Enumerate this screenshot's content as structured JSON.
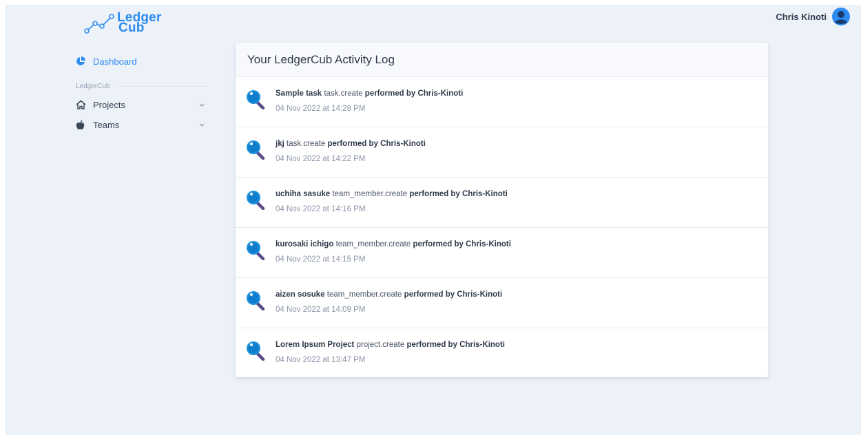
{
  "brand": {
    "line1": "Ledger",
    "line2": "Cub",
    "color": "#2d8cf0"
  },
  "header": {
    "user_name": "Chris Kinoti",
    "avatar_icon": "user-circle-icon"
  },
  "sidebar": {
    "dashboard_label": "Dashboard",
    "section_label": "LedgerCub",
    "items": [
      {
        "label": "Projects",
        "icon": "house-icon"
      },
      {
        "label": "Teams",
        "icon": "apple-icon"
      }
    ]
  },
  "activity": {
    "title": "Your LedgerCub Activity Log",
    "entries": [
      {
        "subject": "Sample task",
        "action": "task.create",
        "performer": "performed by Chris-Kinoti",
        "time": "04 Nov 2022 at 14:28 PM"
      },
      {
        "subject": "jkj",
        "action": "task.create",
        "performer": "performed by Chris-Kinoti",
        "time": "04 Nov 2022 at 14:22 PM"
      },
      {
        "subject": "uchiha sasuke",
        "action": "team_member.create",
        "performer": "performed by Chris-Kinoti",
        "time": "04 Nov 2022 at 14:16 PM"
      },
      {
        "subject": "kurosaki ichigo",
        "action": "team_member.create",
        "performer": "performed by Chris-Kinoti",
        "time": "04 Nov 2022 at 14:15 PM"
      },
      {
        "subject": "aizen sosuke",
        "action": "team_member.create",
        "performer": "performed by Chris-Kinoti",
        "time": "04 Nov 2022 at 14:09 PM"
      },
      {
        "subject": "Lorem Ipsum Project",
        "action": "project.create",
        "performer": "performed by Chris-Kinoti",
        "time": "04 Nov 2022 at 13:47 PM"
      }
    ]
  }
}
